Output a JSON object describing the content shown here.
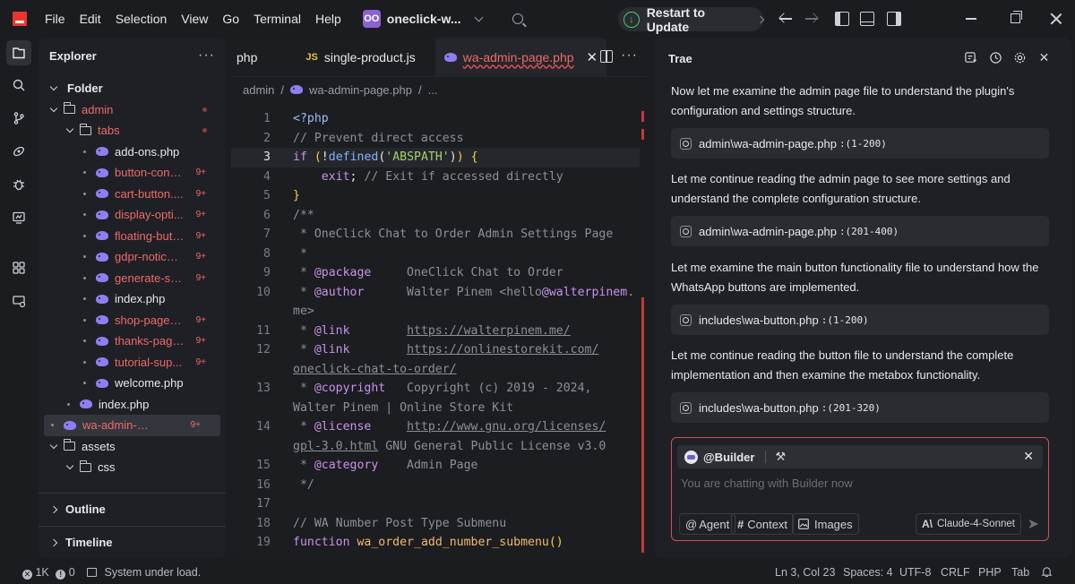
{
  "titlebar": {
    "menu": [
      "File",
      "Edit",
      "Selection",
      "View",
      "Go",
      "Terminal",
      "Help"
    ],
    "project_badge": "OO",
    "project_name": "oneclick-w...",
    "restart_label": "Restart to Update"
  },
  "explorer": {
    "title": "Explorer",
    "more": "···",
    "root": "Folder",
    "items": [
      {
        "name": "admin",
        "kind": "folder",
        "error": true
      },
      {
        "name": "tabs",
        "kind": "folder",
        "error": true
      },
      {
        "name": "add-ons.php",
        "kind": "php",
        "error": false
      },
      {
        "name": "button-confi...",
        "kind": "php",
        "error": true,
        "count": "9+"
      },
      {
        "name": "cart-button....",
        "kind": "php",
        "error": true,
        "count": "9+"
      },
      {
        "name": "display-opti...",
        "kind": "php",
        "error": true,
        "count": "9+"
      },
      {
        "name": "floating-butt...",
        "kind": "php",
        "error": true,
        "count": "9+"
      },
      {
        "name": "gdpr-notice....",
        "kind": "php",
        "error": true,
        "count": "9+"
      },
      {
        "name": "generate-sh...",
        "kind": "php",
        "error": true,
        "count": "9+"
      },
      {
        "name": "index.php",
        "kind": "php",
        "error": false
      },
      {
        "name": "shop-page.p...",
        "kind": "php",
        "error": true,
        "count": "9+"
      },
      {
        "name": "thanks-page...",
        "kind": "php",
        "error": true,
        "count": "9+"
      },
      {
        "name": "tutorial-sup...",
        "kind": "php",
        "error": true,
        "count": "9+"
      },
      {
        "name": "welcome.php",
        "kind": "php",
        "error": false
      },
      {
        "name": "index.php",
        "kind": "php",
        "error": false
      },
      {
        "name": "wa-admin-pag...",
        "kind": "php",
        "error": true,
        "count": "9+"
      },
      {
        "name": "assets",
        "kind": "folder",
        "error": false
      },
      {
        "name": "css",
        "kind": "folder",
        "error": false
      }
    ],
    "outline": "Outline",
    "timeline": "Timeline"
  },
  "editor": {
    "tabs": [
      {
        "label": "php",
        "icon": "php-icon"
      },
      {
        "label": "single-product.js",
        "icon": "js-icon",
        "icon_text": "JS"
      },
      {
        "label": "wa-admin-page.php",
        "icon": "php-icon",
        "active": true
      }
    ],
    "tab_close": "✕",
    "breadcrumb": [
      "admin",
      "wa-admin-page.php",
      "..."
    ],
    "current_line": "3",
    "lines": [
      {
        "n": "1",
        "t": "<?php"
      },
      {
        "n": "2",
        "t": "// Prevent direct access"
      },
      {
        "n": "3",
        "t": "if (!defined('ABSPATH')) {"
      },
      {
        "n": "4",
        "t": "    exit; // Exit if accessed directly"
      },
      {
        "n": "5",
        "t": "}"
      },
      {
        "n": "6",
        "t": "/**"
      },
      {
        "n": "7",
        "t": " * OneClick Chat to Order Admin Settings Page"
      },
      {
        "n": "8",
        "t": " *"
      },
      {
        "n": "9",
        "t": " * @package     OneClick Chat to Order"
      },
      {
        "n": "10",
        "t": " * @author      Walter Pinem <hello@walterpinem."
      },
      {
        "n": "",
        "t": "me>"
      },
      {
        "n": "11",
        "t": " * @link        https://walterpinem.me/"
      },
      {
        "n": "12",
        "t": " * @link        https://onlinestorekit.com/"
      },
      {
        "n": "",
        "t": "oneclick-chat-to-order/"
      },
      {
        "n": "13",
        "t": " * @copyright   Copyright (c) 2019 - 2024,"
      },
      {
        "n": "",
        "t": "Walter Pinem | Online Store Kit"
      },
      {
        "n": "14",
        "t": " * @license     http://www.gnu.org/licenses/"
      },
      {
        "n": "",
        "t": "gpl-3.0.html GNU General Public License v3.0"
      },
      {
        "n": "15",
        "t": " * @category    Admin Page"
      },
      {
        "n": "16",
        "t": " */"
      },
      {
        "n": "17",
        "t": ""
      },
      {
        "n": "18",
        "t": "// WA Number Post Type Submenu"
      },
      {
        "n": "19",
        "t": "function wa_order_add_number_submenu()"
      }
    ]
  },
  "chat": {
    "title": "Trae",
    "messages": [
      {
        "text": "Now let me examine the admin page file to understand the plugin's configuration and settings structure.",
        "file": "admin\\wa-admin-page.php",
        "range": ":(1-200)"
      },
      {
        "text": "Let me continue reading the admin page to see more settings and understand the complete configuration structure.",
        "file": "admin\\wa-admin-page.php",
        "range": ":(201-400)"
      },
      {
        "text": "Let me examine the main button functionality file to understand how the WhatsApp buttons are implemented.",
        "file": "includes\\wa-button.php",
        "range": ":(1-200)"
      },
      {
        "text": "Let me continue reading the button file to understand the complete implementation and then examine the metabox functionality.",
        "file": "includes\\wa-button.php",
        "range": ":(201-320)"
      }
    ],
    "agent_label": "@Builder",
    "placeholder": "You are chatting with Builder now",
    "chips": {
      "agent": "Agent",
      "context": "Context",
      "images": "Images"
    },
    "model": "Claude-4-Sonnet"
  },
  "status": {
    "errors": "1K",
    "warnings": "0",
    "message": "System under load.",
    "position": "Ln 3, Col 23",
    "spaces": "Spaces: 4",
    "encoding": "UTF-8",
    "eol": "CRLF",
    "language": "PHP",
    "tab": "Tab"
  },
  "colors": {
    "accent": "#8a63d2",
    "error": "#ec6a6a",
    "restart_icon": "#4ec77a"
  }
}
